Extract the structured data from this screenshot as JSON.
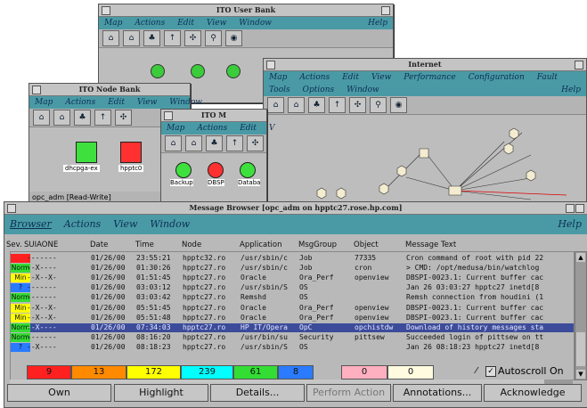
{
  "colors": {
    "critical": "#ff2020",
    "major": "#ff8a00",
    "minor": "#ffff00",
    "warning": "#00ffff",
    "normal": "#33dd33",
    "unknown": "#2a7bff",
    "accent_menu": "#4a9aa6",
    "selection": "#3c4c9a"
  },
  "user_bank": {
    "title": "ITO User Bank",
    "menu": [
      "Map",
      "Actions",
      "Edit",
      "View",
      "Window"
    ],
    "help": "Help"
  },
  "internet": {
    "title": "Internet",
    "menu": [
      "Map",
      "Actions",
      "Edit",
      "View",
      "Performance",
      "Configuration",
      "Fault"
    ],
    "menu2": [
      "Tools",
      "Options",
      "Window"
    ],
    "help": "Help"
  },
  "node_bank": {
    "title": "ITO Node Bank",
    "menu": [
      "Map",
      "Actions",
      "Edit",
      "View",
      "Window"
    ],
    "nodes": [
      "dhcpga-ex",
      "hpptc0"
    ],
    "status": "opc_adm [Read-Write]"
  },
  "ito_m": {
    "title": "ITO M",
    "menu": [
      "Map",
      "Actions",
      "Edit",
      "V"
    ],
    "nodes": [
      "Backup",
      "DBSP",
      "Databa"
    ]
  },
  "mb": {
    "title": "Message Browser [opc_adm on hpptc27.rose.hp.com]",
    "menu": [
      "Browser",
      "Actions",
      "View",
      "Window"
    ],
    "help": "Help",
    "columns": [
      "Sev.",
      "SUIAONE",
      "Date",
      "Time",
      "Node",
      "Application",
      "MsgGroup",
      "Object",
      "Message Text"
    ],
    "rows": [
      {
        "sev": "",
        "sev_color": "#ff2020",
        "flags": "-------",
        "date": "01/26/00",
        "time": "23:55:21",
        "node": "hpptc32.ro",
        "app": "/usr/sbin/c",
        "group": "Job",
        "object": "77335",
        "text": "Cron command of root with pid 22"
      },
      {
        "sev": "Norm",
        "sev_color": "#33dd33",
        "flags": "--X----",
        "date": "01/26/00",
        "time": "01:30:26",
        "node": "hpptc27.ro",
        "app": "/usr/sbin/c",
        "group": "Job",
        "object": "cron",
        "text": "> CMD: /opt/medusa/bin/watchlog"
      },
      {
        "sev": "Min",
        "sev_color": "#ffff00",
        "flags": "--X--X-",
        "date": "01/26/00",
        "time": "01:51:45",
        "node": "hpptc27.ro",
        "app": "Oracle",
        "group": "Ora_Perf",
        "object": "openview",
        "text": "DBSPI-0023.1: Current buffer cac"
      },
      {
        "sev": "?",
        "sev_color": "#2a7bff",
        "flags": "-------",
        "date": "01/26/00",
        "time": "03:03:12",
        "node": "hpptc27.ro",
        "app": "/usr/sbin/S",
        "group": "OS",
        "object": "",
        "text": "Jan 26 03:03:27 hpptc27 inetd[8"
      },
      {
        "sev": "Norm",
        "sev_color": "#33dd33",
        "flags": "-------",
        "date": "01/26/00",
        "time": "03:03:42",
        "node": "hpptc27.ro",
        "app": "Remshd",
        "group": "OS",
        "object": "",
        "text": "Remsh connection from houdini (1"
      },
      {
        "sev": "Min",
        "sev_color": "#ffff00",
        "flags": "--X--X-",
        "date": "01/26/00",
        "time": "05:51:45",
        "node": "hpptc27.ro",
        "app": "Oracle",
        "group": "Ora_Perf",
        "object": "openview",
        "text": "DBSPI-0023.1: Current buffer cac"
      },
      {
        "sev": "Min",
        "sev_color": "#ffff00",
        "flags": "--X--X-",
        "date": "01/26/00",
        "time": "05:51:48",
        "node": "hpptc27.ro",
        "app": "Oracle",
        "group": "Ora_Perf",
        "object": "openview",
        "text": "DBSPI-0023.1: Current buffer cac"
      },
      {
        "sev": "Norm",
        "sev_color": "#33dd33",
        "flags": "--X----",
        "date": "01/26/00",
        "time": "07:34:03",
        "node": "hpptc27.ro",
        "app": "HP IT/Opera",
        "group": "OpC",
        "object": "opchistdw",
        "text": "Download of history messages sta"
      },
      {
        "sev": "Norm",
        "sev_color": "#33dd33",
        "flags": "-------",
        "date": "01/26/00",
        "time": "08:16:20",
        "node": "hpptc27.ro",
        "app": "/usr/bin/su",
        "group": "Security",
        "object": "pittsew",
        "text": "Succeeded login of pittsew on tt"
      },
      {
        "sev": "?",
        "sev_color": "#2a7bff",
        "flags": "--X----",
        "date": "01/26/00",
        "time": "08:18:23",
        "node": "hpptc27.ro",
        "app": "/usr/sbin/S",
        "group": "OS",
        "object": "",
        "text": "Jan 26 08:18:23 hpptc27 inetd[8"
      }
    ],
    "selected_index": 7,
    "counts": [
      {
        "value": "9",
        "color": "#ff2020"
      },
      {
        "value": "13",
        "color": "#ff8a00"
      },
      {
        "value": "172",
        "color": "#ffff00"
      },
      {
        "value": "239",
        "color": "#00ffff"
      },
      {
        "value": "61",
        "color": "#33dd33"
      },
      {
        "value": "8",
        "color": "#2a7bff"
      },
      {
        "value": "0",
        "color": "#ffb0c0"
      },
      {
        "value": "0",
        "color": "#fffbe0"
      }
    ],
    "autoscroll_label": "Autoscroll On",
    "buttons": {
      "own": "Own",
      "highlight": "Highlight",
      "details": "Details...",
      "perform": "Perform Action",
      "annotations": "Annotations...",
      "acknowledge": "Acknowledge"
    }
  }
}
